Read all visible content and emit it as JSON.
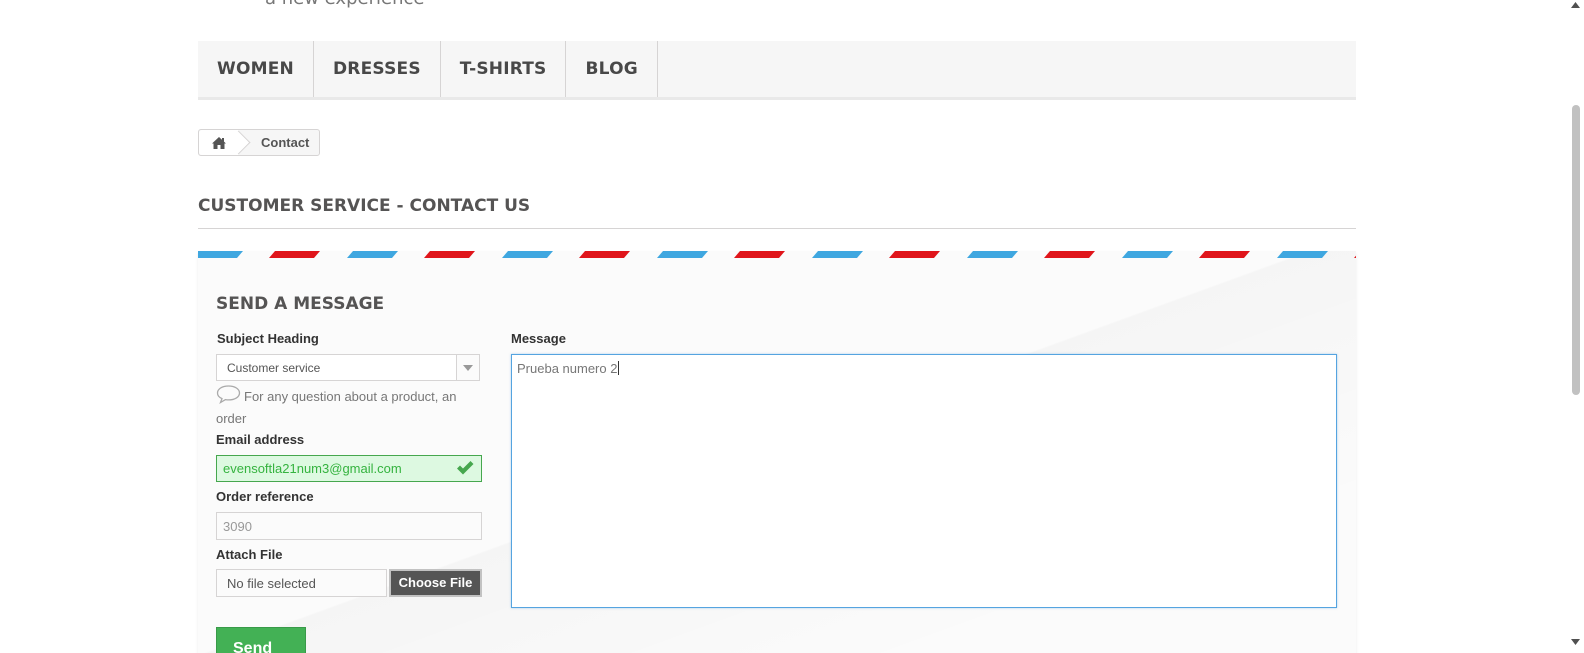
{
  "header": {
    "tagline": "a new experience"
  },
  "nav": {
    "items": [
      "WOMEN",
      "DRESSES",
      "T-SHIRTS",
      "BLOG"
    ]
  },
  "breadcrumb": {
    "home_icon": "home-icon",
    "current": "Contact"
  },
  "page": {
    "title": "CUSTOMER SERVICE - CONTACT US"
  },
  "form": {
    "title": "SEND A MESSAGE",
    "subject": {
      "label": "Subject Heading",
      "value": "Customer service",
      "icon": "chevron-down-icon"
    },
    "hint": {
      "icon": "speech-bubble-icon",
      "text": "For any question about a product, an order"
    },
    "email": {
      "label": "Email address",
      "value": "evensoftla21num3@gmail.com",
      "icon": "check-icon"
    },
    "order": {
      "label": "Order reference",
      "value": "3090"
    },
    "attach": {
      "label": "Attach File",
      "file_name": "No file selected",
      "button": "Choose File"
    },
    "message": {
      "label": "Message",
      "value": "Prueba numero 2"
    },
    "send": {
      "label": "Send",
      "icon": "chevron-right-icon"
    }
  },
  "colors": {
    "accent_blue": "#3fa7e0",
    "accent_red": "#e0151b",
    "success": "#46a74e"
  }
}
